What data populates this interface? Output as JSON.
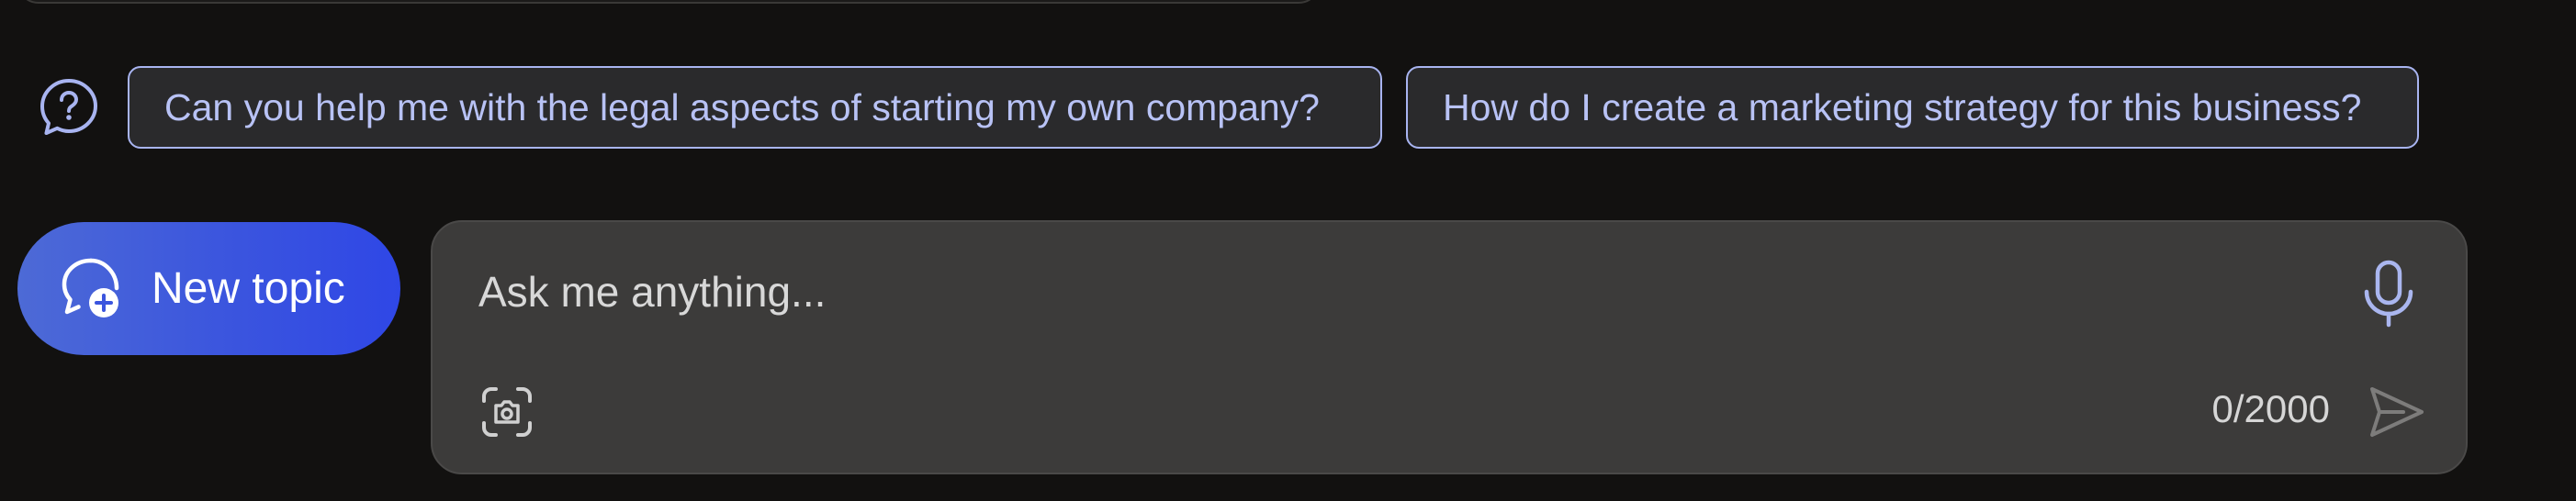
{
  "suggestions": {
    "help_icon": "question-bubble-icon",
    "items": [
      {
        "label": "Can you help me with the legal aspects of starting my own company?"
      },
      {
        "label": "How do I create a marketing strategy for this business?"
      }
    ]
  },
  "new_topic": {
    "icon": "chat-add-icon",
    "label": "New topic"
  },
  "composer": {
    "placeholder": "Ask me anything...",
    "value": "",
    "mic_icon": "microphone-icon",
    "scan_icon": "image-scan-icon",
    "char_count": "0/2000",
    "send_icon": "send-icon"
  },
  "colors": {
    "background": "#121110",
    "accent": "#3b55de",
    "suggestion_border": "#a8b4f0",
    "suggestion_text": "#b8c2f5",
    "panel": "#3c3b3a"
  }
}
